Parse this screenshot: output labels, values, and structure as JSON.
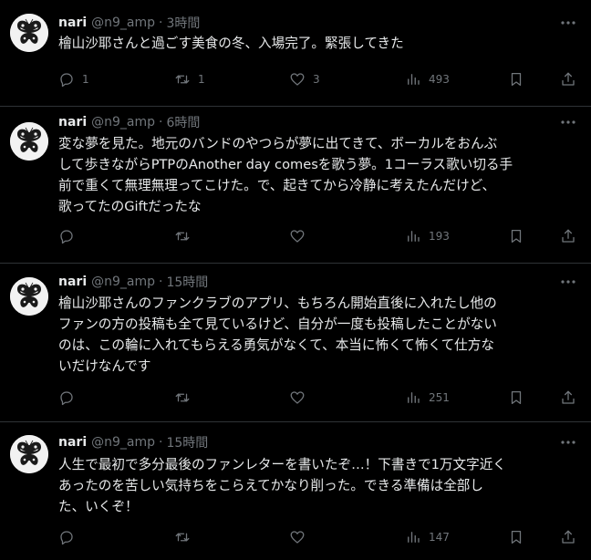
{
  "tweets": [
    {
      "name": "nari",
      "handle": "@n9_amp",
      "dot": "·",
      "time": "3時間",
      "text": "檜山沙耶さんと過ごす美食の冬、入場完了。緊張してきた",
      "replies": "1",
      "retweets": "1",
      "likes": "3",
      "views": "493"
    },
    {
      "name": "nari",
      "handle": "@n9_amp",
      "dot": "·",
      "time": "6時間",
      "text": "変な夢を見た。地元のバンドのやつらが夢に出てきて、ボーカルをおんぶ\nして歩きながらPTPのAnother day comesを歌う夢。1コーラス歌い切る手\n前で重くて無理無理ってこけた。で、起きてから冷静に考えたんだけど、\n歌ってたのGiftだったな",
      "replies": "",
      "retweets": "",
      "likes": "",
      "views": "193"
    },
    {
      "name": "nari",
      "handle": "@n9_amp",
      "dot": "·",
      "time": "15時間",
      "text": "檜山沙耶さんのファンクラブのアプリ、もちろん開始直後に入れたし他の\nファンの方の投稿も全て見ているけど、自分が一度も投稿したことがない\nのは、この輪に入れてもらえる勇気がなくて、本当に怖くて怖くて仕方な\nいだけなんです",
      "replies": "",
      "retweets": "",
      "likes": "",
      "views": "251"
    },
    {
      "name": "nari",
      "handle": "@n9_amp",
      "dot": "·",
      "time": "15時間",
      "text": "人生で最初で多分最後のファンレターを書いたぞ…！下書きで1万文字近く\nあったのを苦しい気持ちをこらえてかなり削った。できる準備は全部し\nた、いくぞ！",
      "replies": "",
      "retweets": "",
      "likes": "",
      "views": "147"
    }
  ],
  "icons": {
    "avatar": "butterfly-avatar-icon",
    "more": "more-dots-icon",
    "reply": "reply-icon",
    "retweet": "retweet-icon",
    "like": "heart-icon",
    "views": "views-chart-icon",
    "bookmark": "bookmark-icon",
    "share": "share-icon"
  },
  "colors": {
    "background": "#000000",
    "text": "#e7e9ea",
    "muted": "#71767b",
    "divider": "#2f3336"
  }
}
